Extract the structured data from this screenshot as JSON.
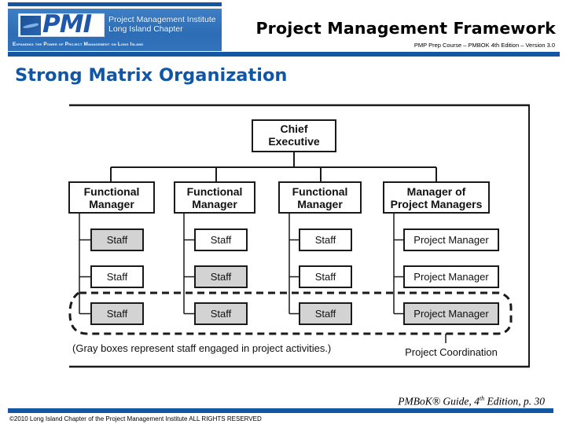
{
  "header": {
    "logo": {
      "mark": "PMI",
      "org_line1": "Project Management Institute",
      "org_line2": "Long Island Chapter",
      "tagline": "Expanding the Power of Project Management on Long Island"
    },
    "title": "Project Management Framework",
    "subtitle": "PMP Prep Course – PMBOK 4th Edition – Version 3.0"
  },
  "slide": {
    "title": "Strong Matrix Organization"
  },
  "diagram": {
    "root": {
      "label_lines": [
        "Chief",
        "Executive"
      ]
    },
    "columns": [
      {
        "head_lines": [
          "Functional",
          "Manager"
        ],
        "items": [
          {
            "label": "Staff",
            "gray": true
          },
          {
            "label": "Staff",
            "gray": false
          },
          {
            "label": "Staff",
            "gray": true
          }
        ]
      },
      {
        "head_lines": [
          "Functional",
          "Manager"
        ],
        "items": [
          {
            "label": "Staff",
            "gray": false
          },
          {
            "label": "Staff",
            "gray": true
          },
          {
            "label": "Staff",
            "gray": true
          }
        ]
      },
      {
        "head_lines": [
          "Functional",
          "Manager"
        ],
        "items": [
          {
            "label": "Staff",
            "gray": false
          },
          {
            "label": "Staff",
            "gray": false
          },
          {
            "label": "Staff",
            "gray": true
          }
        ]
      },
      {
        "head_lines": [
          "Manager of",
          "Project Managers"
        ],
        "items": [
          {
            "label": "Project Manager",
            "gray": false
          },
          {
            "label": "Project Manager",
            "gray": false
          },
          {
            "label": "Project Manager",
            "gray": true
          }
        ]
      }
    ],
    "note": "(Gray boxes represent staff engaged in project activities.)",
    "coordination_label": "Project Coordination",
    "colors": {
      "gray_fill": "#d3d3d3",
      "line": "#1a1a1a"
    }
  },
  "citation": {
    "text_before": "PMBoK® Guide, 4",
    "sup": "th",
    "text_after": " Edition, p. 30"
  },
  "footer": {
    "copyright": "©2010 Long Island Chapter of the Project Management Institute  ALL RIGHTS RESERVED"
  }
}
